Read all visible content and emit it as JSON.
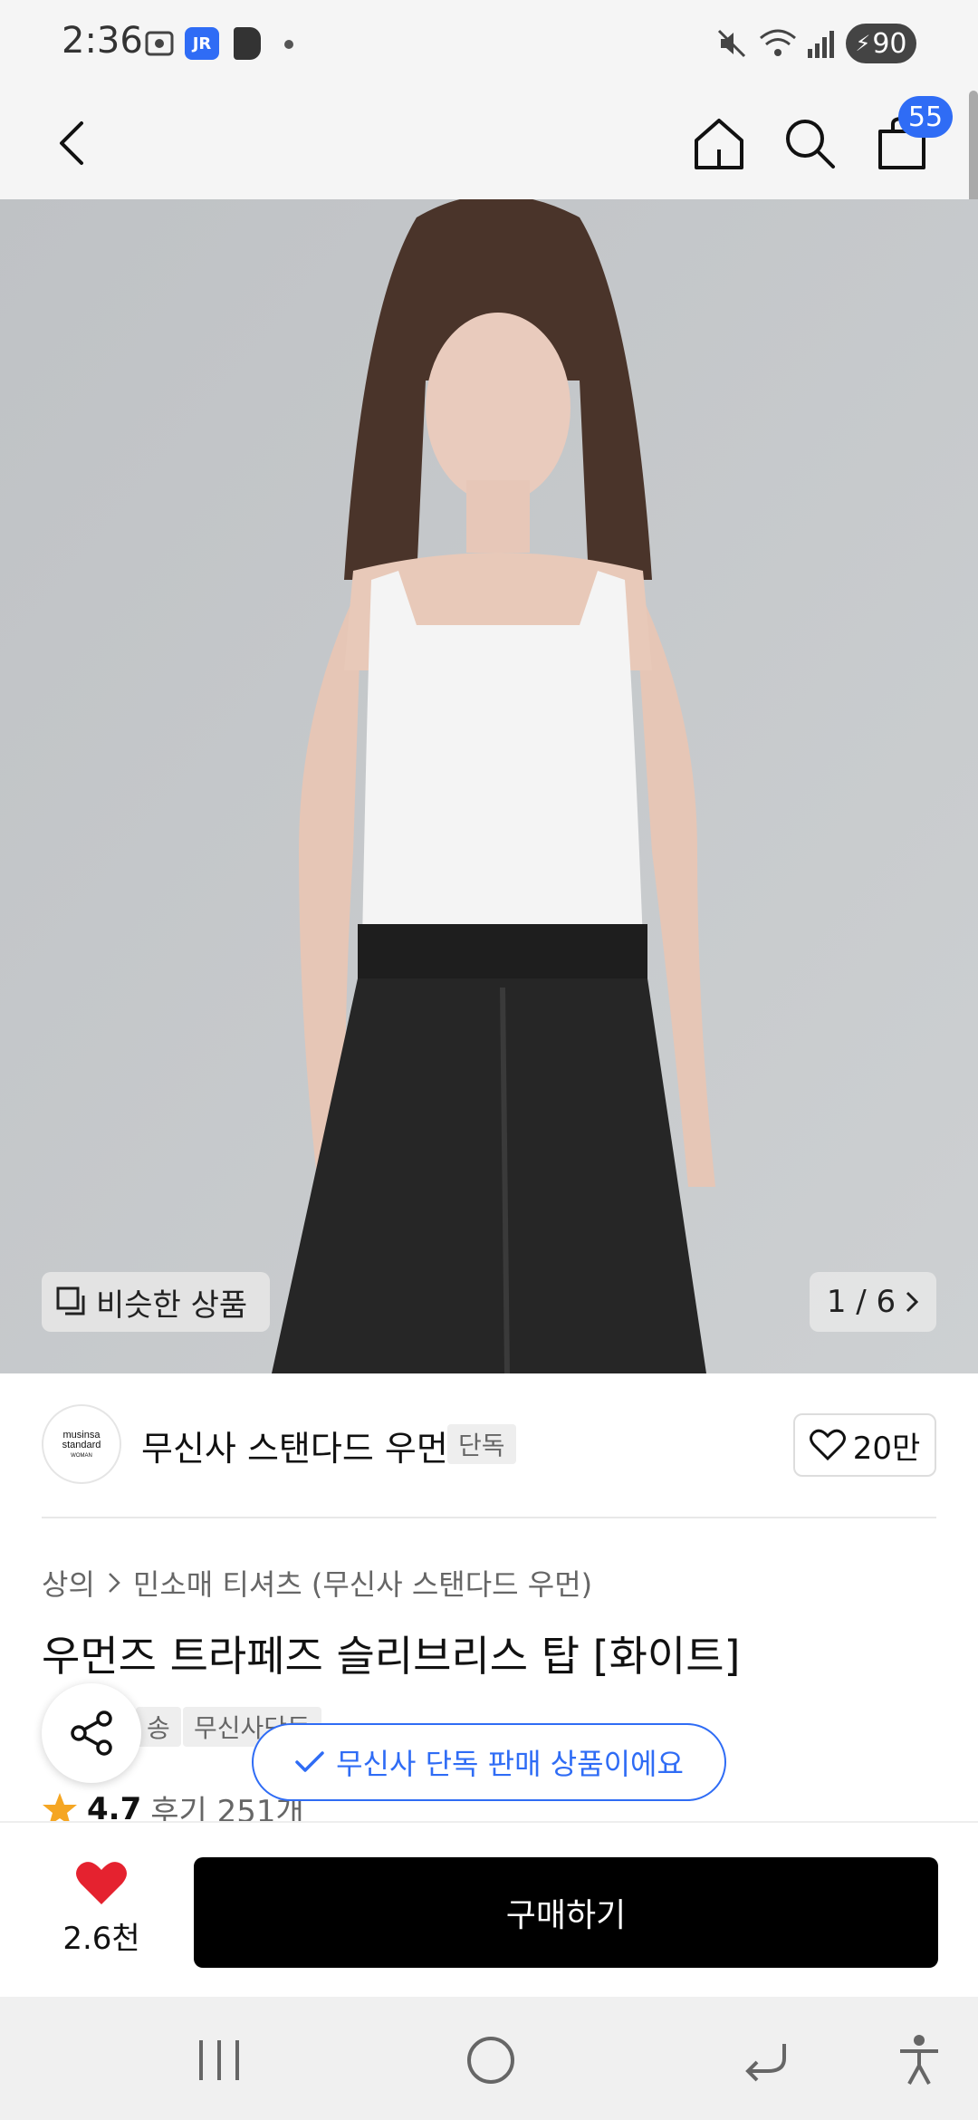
{
  "status_bar": {
    "time": "2:36",
    "battery": "90"
  },
  "header": {
    "cart_count": "55"
  },
  "hero": {
    "similar_label": "비슷한 상품",
    "pager": "1 / 6"
  },
  "brand": {
    "logo_line1": "musinsa",
    "logo_line2": "standard",
    "logo_line3": "WOMAN",
    "name": "무신사 스탠다드 우먼",
    "tag": "단독",
    "likes": "20만"
  },
  "product": {
    "breadcrumb": [
      "상의",
      "민소매 티셔츠 (무신사 스탠다드 우먼)"
    ],
    "title": "우먼즈 트라페즈 슬리브리스 탑 [화이트]",
    "tags": [
      "송",
      "무신사단독"
    ],
    "rating": "4.7",
    "reviews": "후기 251개"
  },
  "toast": {
    "text": "무신사 단독 판매 상품이에요"
  },
  "bottom": {
    "wish_count": "2.6천",
    "buy_label": "구매하기"
  },
  "colors": {
    "accent": "#2f6cf5",
    "heart": "#e5222f",
    "star": "#f5a623"
  }
}
